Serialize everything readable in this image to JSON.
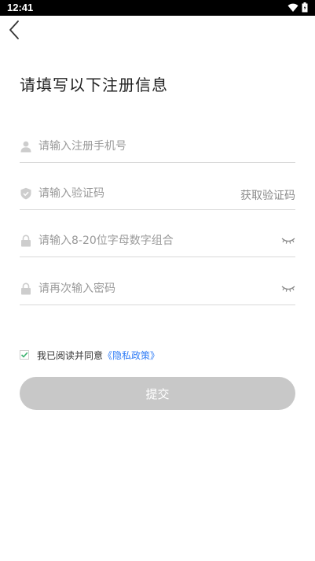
{
  "status_bar": {
    "time": "12:41"
  },
  "header": {
    "title": "请填写以下注册信息"
  },
  "form": {
    "phone": {
      "placeholder": "请输入注册手机号",
      "value": ""
    },
    "code": {
      "placeholder": "请输入验证码",
      "value": "",
      "action_label": "获取验证码"
    },
    "password": {
      "placeholder": "请输入8-20位字母数字组合",
      "value": ""
    },
    "confirm_password": {
      "placeholder": "请再次输入密码",
      "value": ""
    }
  },
  "agreement": {
    "checked": true,
    "text": "我已阅读并同意",
    "link_text": "《隐私政策》"
  },
  "submit": {
    "label": "提交"
  },
  "colors": {
    "link": "#2f7cf6",
    "check": "#3cb371",
    "button_disabled": "#c8c8c8"
  },
  "icons": [
    "back-icon",
    "user-icon",
    "shield-icon",
    "lock-icon",
    "eye-closed-icon",
    "wifi-icon",
    "battery-icon"
  ]
}
